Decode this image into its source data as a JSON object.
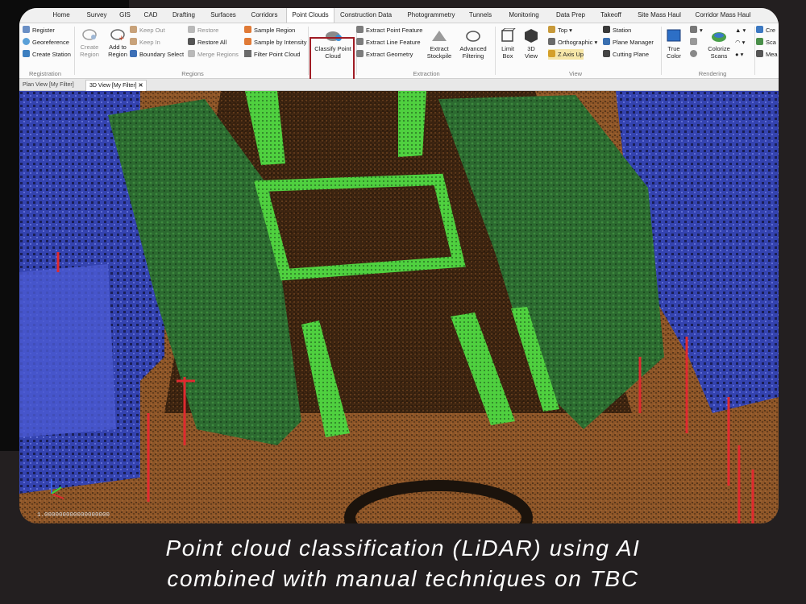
{
  "app": {
    "tabs": [
      "Home",
      "Survey",
      "GIS",
      "CAD",
      "Drafting",
      "Surfaces",
      "Corridors",
      "Point Clouds",
      "Construction Data",
      "Photogrammetry",
      "Tunnels",
      "Monitoring",
      "Data Prep",
      "Takeoff",
      "Site Mass Haul",
      "Corridor Mass Haul"
    ],
    "active_tab": "Point Clouds"
  },
  "ribbon": {
    "registration": {
      "items": [
        "Register",
        "Georeference",
        "Create Station"
      ],
      "label": "Registration"
    },
    "regions": {
      "create_region": "Create Region",
      "add_to_region": "Add to Region",
      "col1": [
        "Keep Out",
        "Keep In",
        "Boundary Select"
      ],
      "col2": [
        "Restore",
        "Restore All",
        "Merge Regions"
      ],
      "col3": [
        "Sample Region",
        "Sample by Intensity",
        "Filter Point Cloud"
      ],
      "label": "Regions"
    },
    "classify": "Classify Point Cloud",
    "extraction": {
      "items": [
        "Extract Point Feature",
        "Extract Line Feature",
        "Extract Geometry"
      ],
      "extract_stockpile": "Extract Stockpile",
      "advanced_filtering": "Advanced Filtering",
      "label": "Extraction"
    },
    "view": {
      "limit_box": "Limit Box",
      "view_3d": "3D View",
      "col": [
        "Top",
        "Orthographic",
        "Z Axis Up"
      ],
      "col2": [
        "Station",
        "Plane Manager",
        "Cutting Plane"
      ],
      "label": "View"
    },
    "rendering": {
      "true_color": "True Color",
      "colorize_scans": "Colorize Scans",
      "extra": [
        "Cre",
        "Sca",
        "Mea"
      ],
      "label": "Rendering"
    }
  },
  "doc_tabs": [
    "Plan View [My Filter]",
    "3D View [My Filter]"
  ],
  "viewport": {
    "scale_text": "1.000000000000000000"
  },
  "caption": {
    "line1": "Point cloud classification (LiDAR) using AI",
    "line2": "combined with manual techniques on TBC"
  },
  "colors": {
    "ground": "#9a5e2c",
    "vegetation_high": "#2f6e33",
    "vegetation_low": "#55d447",
    "building": "#3747b8",
    "pole": "#e0292f",
    "highlight": "#a01c24"
  }
}
